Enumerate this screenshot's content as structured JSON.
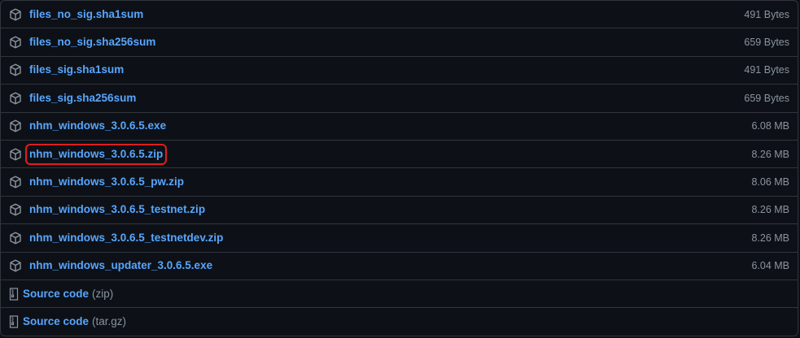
{
  "assets": [
    {
      "name": "files_no_sig.sha1sum",
      "size": "491 Bytes",
      "icon": "package-icon"
    },
    {
      "name": "files_no_sig.sha256sum",
      "size": "659 Bytes",
      "icon": "package-icon"
    },
    {
      "name": "files_sig.sha1sum",
      "size": "491 Bytes",
      "icon": "package-icon"
    },
    {
      "name": "files_sig.sha256sum",
      "size": "659 Bytes",
      "icon": "package-icon"
    },
    {
      "name": "nhm_windows_3.0.6.5.exe",
      "size": "6.08 MB",
      "icon": "package-icon"
    },
    {
      "name": "nhm_windows_3.0.6.5.zip",
      "size": "8.26 MB",
      "icon": "package-icon",
      "highlighted": true,
      "highlight_color": "#e11d1d"
    },
    {
      "name": "nhm_windows_3.0.6.5_pw.zip",
      "size": "8.06 MB",
      "icon": "package-icon"
    },
    {
      "name": "nhm_windows_3.0.6.5_testnet.zip",
      "size": "8.26 MB",
      "icon": "package-icon"
    },
    {
      "name": "nhm_windows_3.0.6.5_testnetdev.zip",
      "size": "8.26 MB",
      "icon": "package-icon"
    },
    {
      "name": "nhm_windows_updater_3.0.6.5.exe",
      "size": "6.04 MB",
      "icon": "package-icon"
    }
  ],
  "source_code": [
    {
      "label": "Source code",
      "format": "(zip)",
      "icon": "file-zip-icon"
    },
    {
      "label": "Source code",
      "format": "(tar.gz)",
      "icon": "file-zip-icon"
    }
  ],
  "colors": {
    "background": "#0d1117",
    "border": "#30363d",
    "link": "#58a6ff",
    "muted": "#8b949e",
    "highlight": "#e11d1d"
  }
}
